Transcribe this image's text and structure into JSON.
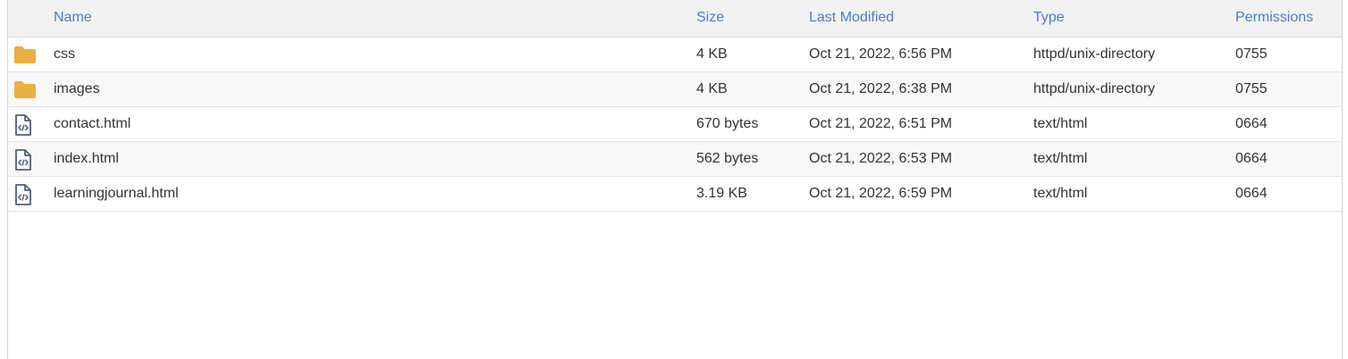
{
  "columns": {
    "name": "Name",
    "size": "Size",
    "modified": "Last Modified",
    "type": "Type",
    "permissions": "Permissions"
  },
  "colors": {
    "header_link": "#4a7cc9",
    "folder": "#e9b043",
    "file_icon": "#4f5f7c"
  },
  "files": [
    {
      "icon": "folder-icon",
      "name": "css",
      "size": "4 KB",
      "modified": "Oct 21, 2022, 6:56 PM",
      "type": "httpd/unix-directory",
      "permissions": "0755"
    },
    {
      "icon": "folder-icon",
      "name": "images",
      "size": "4 KB",
      "modified": "Oct 21, 2022, 6:38 PM",
      "type": "httpd/unix-directory",
      "permissions": "0755"
    },
    {
      "icon": "html-file-icon",
      "name": "contact.html",
      "size": "670 bytes",
      "modified": "Oct 21, 2022, 6:51 PM",
      "type": "text/html",
      "permissions": "0664"
    },
    {
      "icon": "html-file-icon",
      "name": "index.html",
      "size": "562 bytes",
      "modified": "Oct 21, 2022, 6:53 PM",
      "type": "text/html",
      "permissions": "0664"
    },
    {
      "icon": "html-file-icon",
      "name": "learningjournal.html",
      "size": "3.19 KB",
      "modified": "Oct 21, 2022, 6:59 PM",
      "type": "text/html",
      "permissions": "0664"
    }
  ]
}
